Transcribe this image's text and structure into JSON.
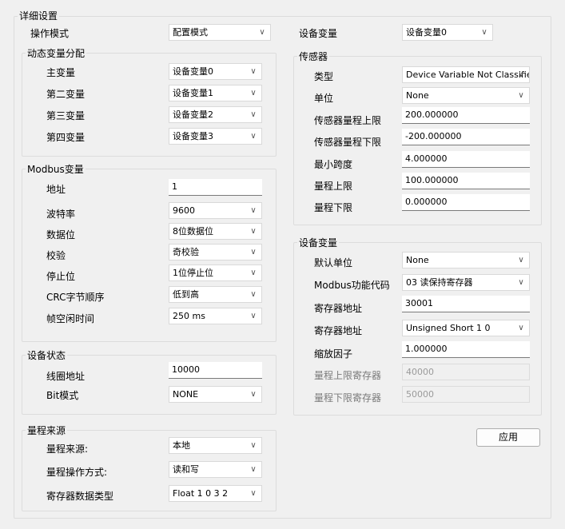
{
  "title": "详细设置",
  "op_mode": {
    "label": "操作模式",
    "value": "配置模式"
  },
  "device_var_select": {
    "label": "设备变量",
    "value": "设备变量0"
  },
  "dyn": {
    "title": "动态变量分配",
    "rows": [
      {
        "label": "主变量",
        "value": "设备变量0"
      },
      {
        "label": "第二变量",
        "value": "设备变量1"
      },
      {
        "label": "第三变量",
        "value": "设备变量2"
      },
      {
        "label": "第四变量",
        "value": "设备变量3"
      }
    ]
  },
  "modbus": {
    "title": "Modbus变量",
    "address": {
      "label": "地址",
      "value": "1"
    },
    "baud": {
      "label": "波特率",
      "value": "9600"
    },
    "databits": {
      "label": "数据位",
      "value": "8位数据位"
    },
    "parity": {
      "label": "校验",
      "value": "奇校验"
    },
    "stopbits": {
      "label": "停止位",
      "value": "1位停止位"
    },
    "crc": {
      "label": "CRC字节顺序",
      "value": "低到高"
    },
    "idle": {
      "label": "帧空闲时间",
      "value": "250 ms"
    }
  },
  "status": {
    "title": "设备状态",
    "coil": {
      "label": "线圈地址",
      "value": "10000"
    },
    "bitmode": {
      "label": "Bit模式",
      "value": "NONE"
    }
  },
  "range": {
    "title": "量程来源",
    "source": {
      "label": "量程来源:",
      "value": "本地"
    },
    "opmode": {
      "label": "量程操作方式:",
      "value": "读和写"
    },
    "regtype": {
      "label": "寄存器数据类型",
      "value": "Float 1 0 3 2"
    }
  },
  "sensor": {
    "title": "传感器",
    "type": {
      "label": "类型",
      "value": "Device Variable Not Classified"
    },
    "unit": {
      "label": "单位",
      "value": "None"
    },
    "upper": {
      "label": "传感器量程上限",
      "value": "200.000000"
    },
    "lower": {
      "label": "传感器量程下限",
      "value": "-200.000000"
    },
    "span": {
      "label": "最小跨度",
      "value": "4.000000"
    },
    "rupper": {
      "label": "量程上限",
      "value": "100.000000"
    },
    "rlower": {
      "label": "量程下限",
      "value": "0.000000"
    }
  },
  "devvar": {
    "title": "设备变量",
    "unit": {
      "label": "默认单位",
      "value": "None"
    },
    "func": {
      "label": "Modbus功能代码",
      "value": "03 读保持寄存器"
    },
    "regaddr": {
      "label": "寄存器地址",
      "value": "30001"
    },
    "regtype": {
      "label": "寄存器地址",
      "value": "Unsigned Short 1 0"
    },
    "scale": {
      "label": "缩放因子",
      "value": "1.000000"
    },
    "upreg": {
      "label": "量程上限寄存器",
      "value": "40000"
    },
    "lowreg": {
      "label": "量程下限寄存器",
      "value": "50000"
    }
  },
  "apply_label": "应用",
  "icons": {
    "dropdown": "chevron-down-icon"
  }
}
